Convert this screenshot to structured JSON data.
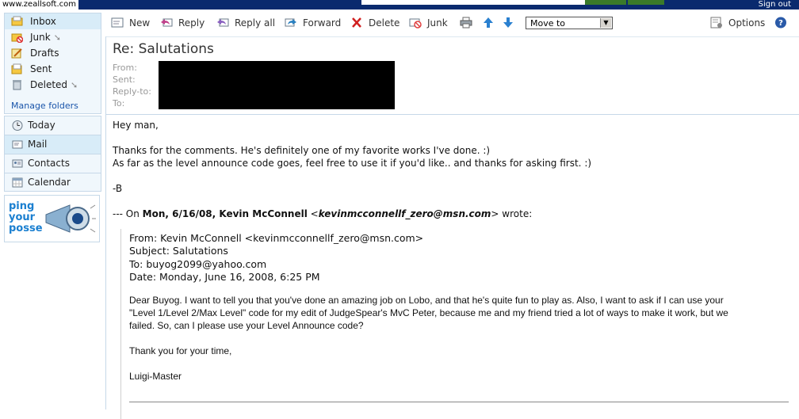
{
  "browser": {
    "url_watermark": "www.zeallsoft.com",
    "sign_out": "Sign out"
  },
  "folders": [
    {
      "label": "Inbox",
      "icon": "inbox-icon",
      "arrow": false
    },
    {
      "label": "Junk",
      "icon": "junk-folder-icon",
      "arrow": true
    },
    {
      "label": "Drafts",
      "icon": "drafts-icon",
      "arrow": false
    },
    {
      "label": "Sent",
      "icon": "sent-icon",
      "arrow": false
    },
    {
      "label": "Deleted",
      "icon": "deleted-icon",
      "arrow": true
    }
  ],
  "manage_folders": "Manage folders",
  "nav": [
    {
      "label": "Today",
      "icon": "clock-icon"
    },
    {
      "label": "Mail",
      "icon": "mail-icon"
    },
    {
      "label": "Contacts",
      "icon": "contacts-icon"
    },
    {
      "label": "Calendar",
      "icon": "calendar-icon"
    }
  ],
  "ad": {
    "text_lines": [
      "ping",
      "your",
      "posse"
    ]
  },
  "toolbar": {
    "new": "New",
    "reply": "Reply",
    "reply_all": "Reply all",
    "forward": "Forward",
    "delete": "Delete",
    "junk": "Junk",
    "move_to": "Move to",
    "options": "Options"
  },
  "message": {
    "subject": "Re: Salutations",
    "header_labels": [
      "From:",
      "Sent:",
      "Reply-to:",
      "To:"
    ],
    "greeting": "Hey man,",
    "line1": "Thanks for the comments. He's definitely one of my favorite works I've done. :)",
    "line2": "As far as the level announce code goes, feel free to use it if you'd like.. and thanks for asking first. :)",
    "signoff": "-B",
    "quote_prefix": "--- On ",
    "quote_date": "Mon, 6/16/08, Kevin McConnell",
    "quote_lt": " <",
    "quote_email": "kevinmcconnellf_zero@msn.com",
    "quote_suffix": "> wrote:",
    "q_from": "From: Kevin McConnell <kevinmcconnellf_zero@msn.com>",
    "q_subject": "Subject: Salutations",
    "q_to": "To: buyog2099@yahoo.com",
    "q_date": "Date: Monday, June 16, 2008, 6:25 PM",
    "q_body1": "Dear Buyog.  I want to tell you that you've done an amazing job on Lobo, and that he's quite fun to play as.  Also, I want to ask if I can use your",
    "q_body2": "\"Level 1/Level 2/Max Level\" code for my edit of JudgeSpear's MvC Peter, because me and my friend tried a lot of ways to make it work, but we",
    "q_body3": "failed.  So, can I please use your Level Announce code?",
    "q_thanks": "Thank you for your time,",
    "q_sign": "Luigi-Master"
  }
}
